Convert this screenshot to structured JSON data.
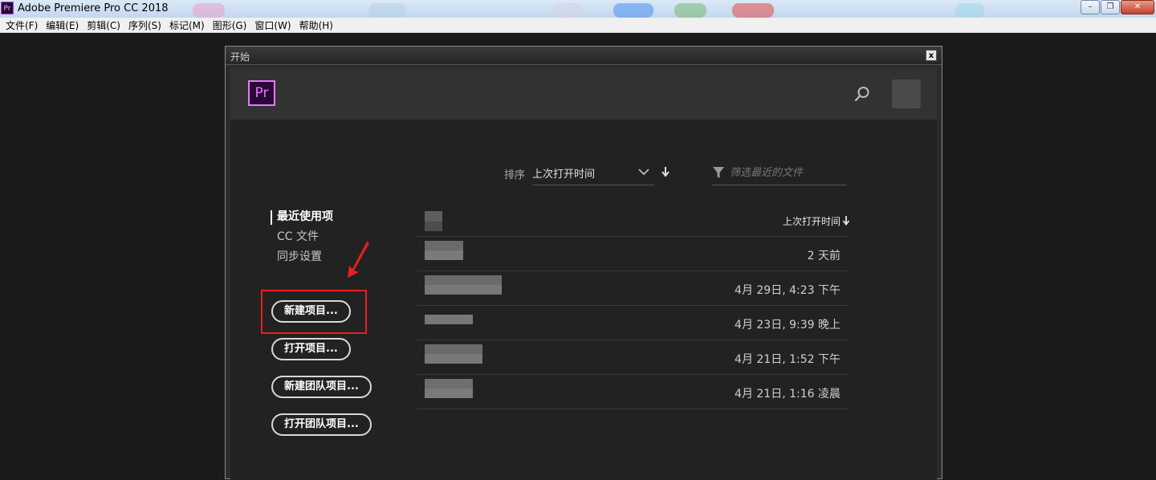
{
  "window": {
    "title": "Adobe Premiere Pro CC 2018",
    "icon_label": "Pr",
    "minimize": "–",
    "restore": "❐",
    "close": "✕"
  },
  "menu": [
    "文件(F)",
    "编辑(E)",
    "剪辑(C)",
    "序列(S)",
    "标记(M)",
    "图形(G)",
    "窗口(W)",
    "帮助(H)"
  ],
  "dialog": {
    "title": "开始",
    "close": "x",
    "logo": "Pr"
  },
  "sort": {
    "label": "排序",
    "value": "上次打开时间",
    "filter_placeholder": "筛选最近的文件"
  },
  "nav": {
    "items": [
      "最近使用项",
      "CC 文件",
      "同步设置"
    ],
    "active_index": 0
  },
  "buttons": [
    "新建项目...",
    "打开项目...",
    "新建团队项目...",
    "打开团队项目..."
  ],
  "table": {
    "header": "上次打开时间",
    "rows": [
      {
        "time": "2 天前"
      },
      {
        "time": "4月 29日, 4:23 下午"
      },
      {
        "time": "4月 23日, 9:39 晚上"
      },
      {
        "time": "4月 21日, 1:52 下午"
      },
      {
        "time": "4月 21日, 1:16 凌晨"
      }
    ]
  },
  "colors": {
    "accent_pr": "#ea77ff",
    "annotation_red": "#e8201d",
    "dialog_bg": "#222222"
  }
}
